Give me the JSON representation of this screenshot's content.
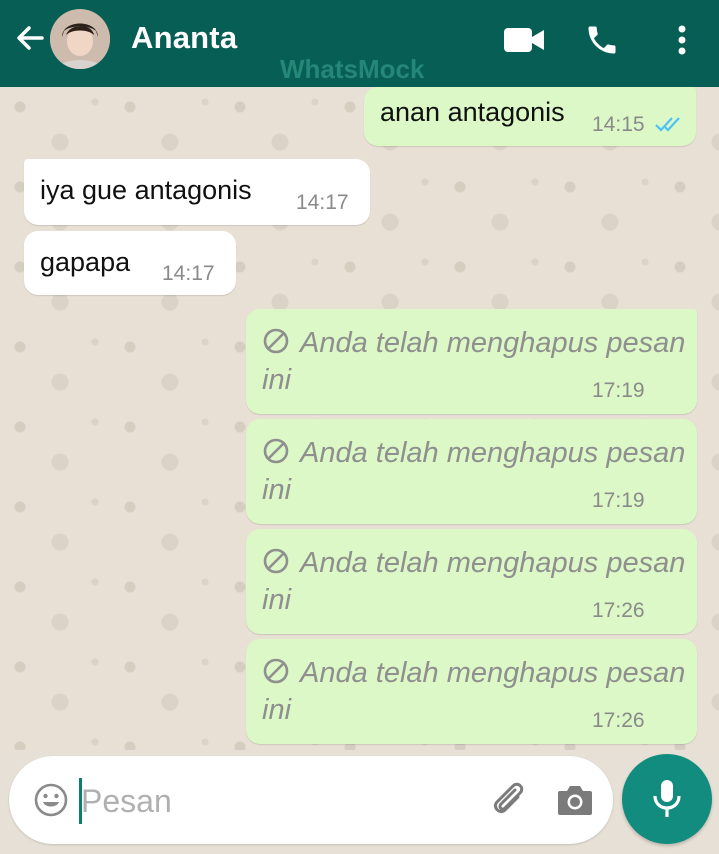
{
  "header": {
    "contact_name": "Ananta",
    "watermark": "WhatsMock",
    "icons": [
      "back-arrow-icon",
      "video-call-icon",
      "voice-call-icon",
      "more-options-icon"
    ]
  },
  "messages": [
    {
      "direction": "out",
      "text": "anan antagonis",
      "time": "14:15",
      "status": "read"
    },
    {
      "direction": "in",
      "text": "iya gue antagonis",
      "time": "14:17"
    },
    {
      "direction": "in",
      "text": "gapapa",
      "time": "14:17"
    },
    {
      "direction": "out",
      "deleted": true,
      "text_line1": "Anda telah menghapus pesan",
      "text_line2": "ini",
      "time": "17:19"
    },
    {
      "direction": "out",
      "deleted": true,
      "text_line1": "Anda telah menghapus pesan",
      "text_line2": "ini",
      "time": "17:19"
    },
    {
      "direction": "out",
      "deleted": true,
      "text_line1": "Anda telah menghapus pesan",
      "text_line2": "ini",
      "time": "17:26"
    },
    {
      "direction": "out",
      "deleted": true,
      "text_line1": "Anda telah menghapus pesan",
      "text_line2": "ini",
      "time": "17:26"
    }
  ],
  "composer": {
    "placeholder": "Pesan",
    "value": ""
  },
  "colors": {
    "header": "#075e54",
    "outgoing_bubble": "#dcf8c6",
    "incoming_bubble": "#ffffff",
    "read_ticks": "#4fc3f7",
    "mic_button": "#128c7e"
  }
}
